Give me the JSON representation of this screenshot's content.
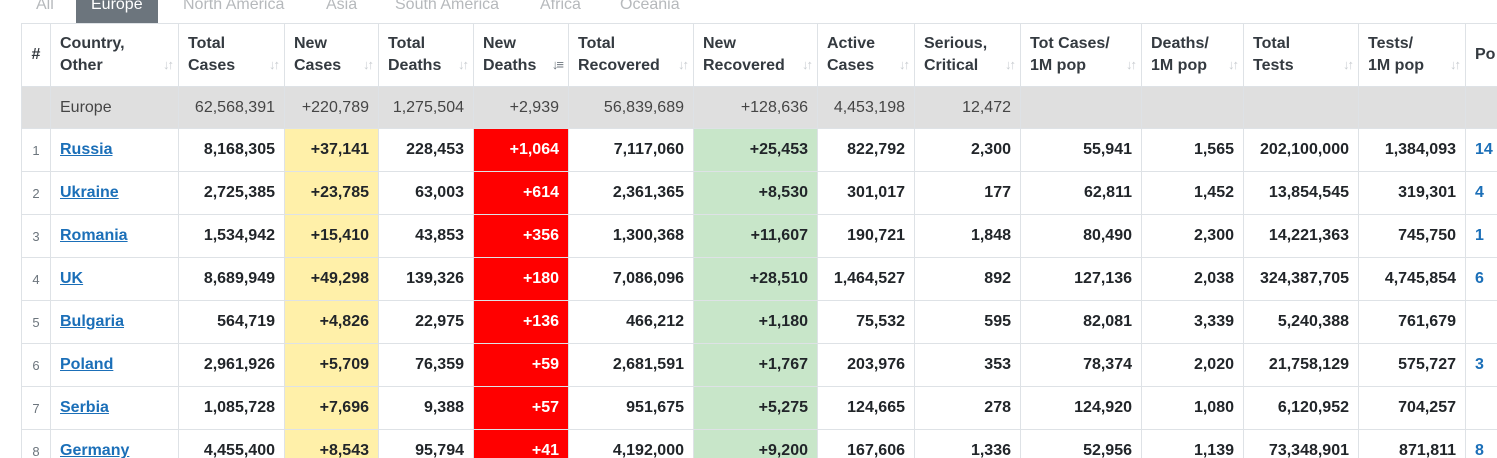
{
  "tabs": [
    "All",
    "Europe",
    "North America",
    "Asia",
    "South America",
    "Africa",
    "Oceania"
  ],
  "active_tab": "Europe",
  "colors": {
    "new_cases_bg": "#fff0a9",
    "new_deaths_bg": "#ff0000",
    "new_recovered_bg": "#c8e6c9",
    "link": "#1b6fb8",
    "tab_active": "#6c757d"
  },
  "columns": [
    {
      "line1": "#",
      "line2": ""
    },
    {
      "line1": "Country,",
      "line2": "Other"
    },
    {
      "line1": "Total",
      "line2": "Cases"
    },
    {
      "line1": "New",
      "line2": "Cases"
    },
    {
      "line1": "Total",
      "line2": "Deaths"
    },
    {
      "line1": "New",
      "line2": "Deaths"
    },
    {
      "line1": "Total",
      "line2": "Recovered"
    },
    {
      "line1": "New",
      "line2": "Recovered"
    },
    {
      "line1": "Active",
      "line2": "Cases"
    },
    {
      "line1": "Serious,",
      "line2": "Critical"
    },
    {
      "line1": "Tot Cases/",
      "line2": "1M pop"
    },
    {
      "line1": "Deaths/",
      "line2": "1M pop"
    },
    {
      "line1": "Total",
      "line2": "Tests"
    },
    {
      "line1": "Tests/",
      "line2": "1M pop"
    },
    {
      "line1": "Po",
      "line2": ""
    }
  ],
  "sort_glyph": "↓↑",
  "sort_active_glyph": "↓≡",
  "total_row": [
    "Europe",
    "62,568,391",
    "+220,789",
    "1,275,504",
    "+2,939",
    "56,839,689",
    "+128,636",
    "4,453,198",
    "12,472",
    "",
    "",
    "",
    "",
    ""
  ],
  "rows": [
    {
      "rank": "1",
      "country": "Russia",
      "total_cases": "8,168,305",
      "new_cases": "+37,141",
      "total_deaths": "228,453",
      "new_deaths": "+1,064",
      "total_recovered": "7,117,060",
      "new_recovered": "+25,453",
      "active": "822,792",
      "critical": "2,300",
      "cases_1m": "55,941",
      "deaths_1m": "1,565",
      "tests": "202,100,000",
      "tests_1m": "1,384,093",
      "pop": "14"
    },
    {
      "rank": "2",
      "country": "Ukraine",
      "total_cases": "2,725,385",
      "new_cases": "+23,785",
      "total_deaths": "63,003",
      "new_deaths": "+614",
      "total_recovered": "2,361,365",
      "new_recovered": "+8,530",
      "active": "301,017",
      "critical": "177",
      "cases_1m": "62,811",
      "deaths_1m": "1,452",
      "tests": "13,854,545",
      "tests_1m": "319,301",
      "pop": "4"
    },
    {
      "rank": "3",
      "country": "Romania",
      "total_cases": "1,534,942",
      "new_cases": "+15,410",
      "total_deaths": "43,853",
      "new_deaths": "+356",
      "total_recovered": "1,300,368",
      "new_recovered": "+11,607",
      "active": "190,721",
      "critical": "1,848",
      "cases_1m": "80,490",
      "deaths_1m": "2,300",
      "tests": "14,221,363",
      "tests_1m": "745,750",
      "pop": "1"
    },
    {
      "rank": "4",
      "country": "UK",
      "total_cases": "8,689,949",
      "new_cases": "+49,298",
      "total_deaths": "139,326",
      "new_deaths": "+180",
      "total_recovered": "7,086,096",
      "new_recovered": "+28,510",
      "active": "1,464,527",
      "critical": "892",
      "cases_1m": "127,136",
      "deaths_1m": "2,038",
      "tests": "324,387,705",
      "tests_1m": "4,745,854",
      "pop": "6"
    },
    {
      "rank": "5",
      "country": "Bulgaria",
      "total_cases": "564,719",
      "new_cases": "+4,826",
      "total_deaths": "22,975",
      "new_deaths": "+136",
      "total_recovered": "466,212",
      "new_recovered": "+1,180",
      "active": "75,532",
      "critical": "595",
      "cases_1m": "82,081",
      "deaths_1m": "3,339",
      "tests": "5,240,388",
      "tests_1m": "761,679",
      "pop": ""
    },
    {
      "rank": "6",
      "country": "Poland",
      "total_cases": "2,961,926",
      "new_cases": "+5,709",
      "total_deaths": "76,359",
      "new_deaths": "+59",
      "total_recovered": "2,681,591",
      "new_recovered": "+1,767",
      "active": "203,976",
      "critical": "353",
      "cases_1m": "78,374",
      "deaths_1m": "2,020",
      "tests": "21,758,129",
      "tests_1m": "575,727",
      "pop": "3"
    },
    {
      "rank": "7",
      "country": "Serbia",
      "total_cases": "1,085,728",
      "new_cases": "+7,696",
      "total_deaths": "9,388",
      "new_deaths": "+57",
      "total_recovered": "951,675",
      "new_recovered": "+5,275",
      "active": "124,665",
      "critical": "278",
      "cases_1m": "124,920",
      "deaths_1m": "1,080",
      "tests": "6,120,952",
      "tests_1m": "704,257",
      "pop": ""
    },
    {
      "rank": "8",
      "country": "Germany",
      "total_cases": "4,455,400",
      "new_cases": "+8,543",
      "total_deaths": "95,794",
      "new_deaths": "+41",
      "total_recovered": "4,192,000",
      "new_recovered": "+9,200",
      "active": "167,606",
      "critical": "1,336",
      "cases_1m": "52,956",
      "deaths_1m": "1,139",
      "tests": "73,348,901",
      "tests_1m": "871,811",
      "pop": "8"
    }
  ]
}
